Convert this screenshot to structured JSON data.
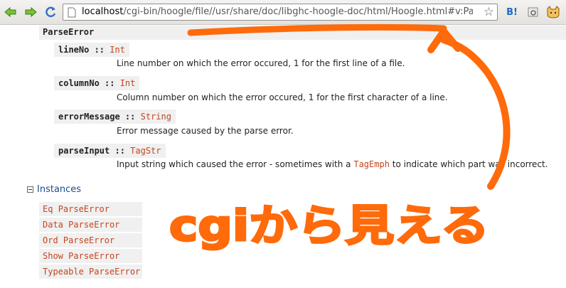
{
  "browser": {
    "url_host": "localhost",
    "url_rest": "/cgi-bin/hoogle/file//usr/share/doc/libghc-hoogle-doc/html/Hoogle.html#v:ParseE",
    "ext_b_label": "B!"
  },
  "doc": {
    "type_name": "ParseError",
    "fields": [
      {
        "name": "lineNo",
        "sep": " :: ",
        "type": "Int",
        "desc": "Line number on which the error occured, 1 for the first line of a file."
      },
      {
        "name": "columnNo",
        "sep": " :: ",
        "type": "Int",
        "desc": "Column number on which the error occured, 1 for the first character of a line."
      },
      {
        "name": "errorMessage",
        "sep": " :: ",
        "type": "String",
        "desc": "Error message caused by the parse error."
      },
      {
        "name": "parseInput",
        "sep": " :: ",
        "type": "TagStr",
        "desc_pre": "Input string which caused the error - sometimes with a ",
        "desc_link": "TagEmph",
        "desc_post": " to indicate which part was incorrect."
      }
    ],
    "instances_title": "Instances",
    "instances": [
      {
        "cls": "Eq",
        "type": "ParseError"
      },
      {
        "cls": "Data",
        "type": "ParseError"
      },
      {
        "cls": "Ord",
        "type": "ParseError"
      },
      {
        "cls": "Show",
        "type": "ParseError"
      },
      {
        "cls": "Typeable",
        "type": "ParseError"
      }
    ]
  },
  "annotation": {
    "text": "cgiから見える",
    "color": "#ff6a0a"
  }
}
